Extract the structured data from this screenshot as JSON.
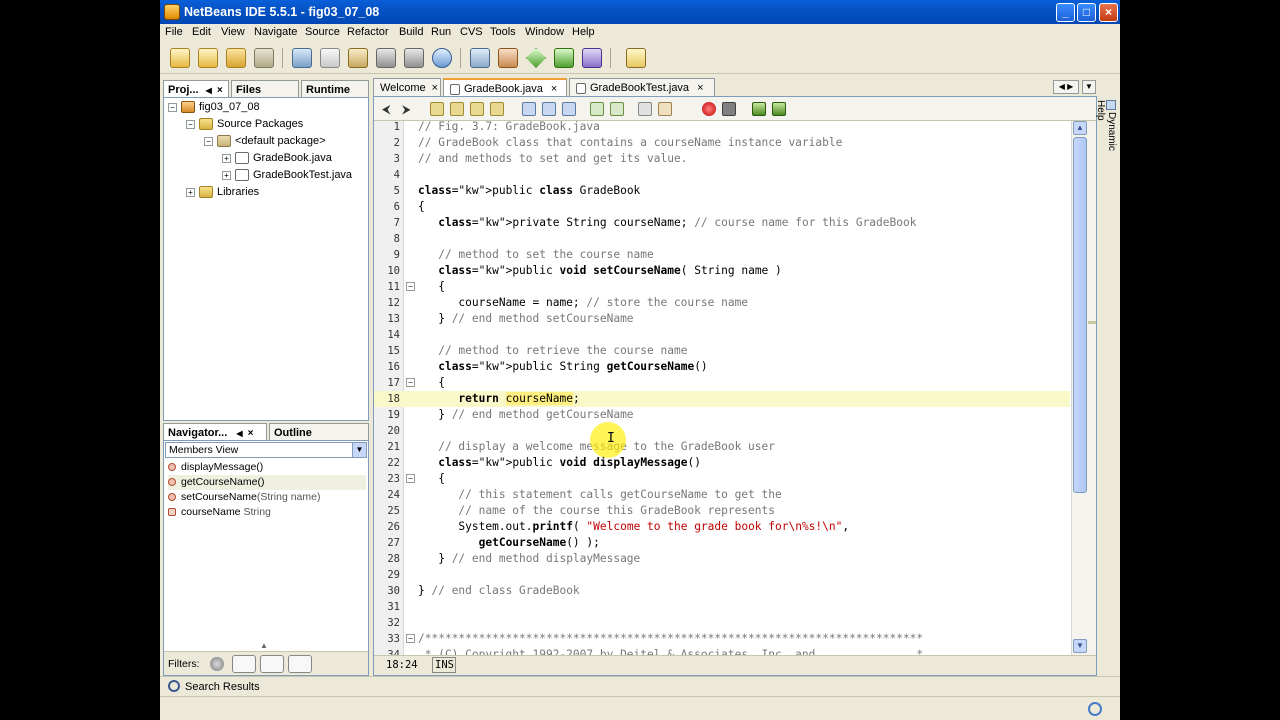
{
  "window": {
    "title": "NetBeans IDE 5.5.1 - fig03_07_08"
  },
  "menu": [
    "File",
    "Edit",
    "View",
    "Navigate",
    "Source",
    "Refactor",
    "Build",
    "Run",
    "CVS",
    "Tools",
    "Window",
    "Help"
  ],
  "left_tabs": {
    "projects": "Proj...",
    "files": "Files",
    "runtime": "Runtime"
  },
  "tree": {
    "project": "fig03_07_08",
    "source_packages": "Source Packages",
    "default_package": "<default package>",
    "file1": "GradeBook.java",
    "file2": "GradeBookTest.java",
    "libraries": "Libraries"
  },
  "navigator": {
    "tab": "Navigator...",
    "outline": "Outline",
    "view": "Members View",
    "items": [
      {
        "name": "displayMessage()",
        "type": ""
      },
      {
        "name": "getCourseName()",
        "type": ""
      },
      {
        "name": "setCourseName",
        "type": "(String name)"
      },
      {
        "name": "courseName",
        "type": " String"
      }
    ],
    "filters": "Filters:"
  },
  "editor_tabs": [
    "Welcome",
    "GradeBook.java",
    "GradeBookTest.java"
  ],
  "dynamic_help": "Dynamic Help",
  "code_lines": [
    {
      "n": "1",
      "t": "// Fig. 3.7: GradeBook.java"
    },
    {
      "n": "2",
      "t": "// GradeBook class that contains a courseName instance variable"
    },
    {
      "n": "3",
      "t": "// and methods to set and get its value."
    },
    {
      "n": "4",
      "t": ""
    },
    {
      "n": "5",
      "t": "public class GradeBook"
    },
    {
      "n": "6",
      "t": "{"
    },
    {
      "n": "7",
      "t": "   private String courseName; // course name for this GradeBook"
    },
    {
      "n": "8",
      "t": ""
    },
    {
      "n": "9",
      "t": "   // method to set the course name"
    },
    {
      "n": "10",
      "t": "   public void setCourseName( String name )"
    },
    {
      "n": "11",
      "t": "   {"
    },
    {
      "n": "12",
      "t": "      courseName = name; // store the course name"
    },
    {
      "n": "13",
      "t": "   } // end method setCourseName"
    },
    {
      "n": "14",
      "t": ""
    },
    {
      "n": "15",
      "t": "   // method to retrieve the course name"
    },
    {
      "n": "16",
      "t": "   public String getCourseName()"
    },
    {
      "n": "17",
      "t": "   {"
    },
    {
      "n": "18",
      "t": "      return courseName;"
    },
    {
      "n": "19",
      "t": "   } // end method getCourseName"
    },
    {
      "n": "20",
      "t": ""
    },
    {
      "n": "21",
      "t": "   // display a welcome message to the GradeBook user"
    },
    {
      "n": "22",
      "t": "   public void displayMessage()"
    },
    {
      "n": "23",
      "t": "   {"
    },
    {
      "n": "24",
      "t": "      // this statement calls getCourseName to get the"
    },
    {
      "n": "25",
      "t": "      // name of the course this GradeBook represents"
    },
    {
      "n": "26",
      "t": "      System.out.printf( \"Welcome to the grade book for\\n%s!\\n\","
    },
    {
      "n": "27",
      "t": "         getCourseName() );"
    },
    {
      "n": "28",
      "t": "   } // end method displayMessage"
    },
    {
      "n": "29",
      "t": ""
    },
    {
      "n": "30",
      "t": "} // end class GradeBook"
    },
    {
      "n": "31",
      "t": ""
    },
    {
      "n": "32",
      "t": ""
    },
    {
      "n": "33",
      "t": "/**************************************************************************"
    },
    {
      "n": "34",
      "t": " * (C) Copyright 1992-2007 by Deitel & Associates, Inc. and               *"
    }
  ],
  "status": {
    "position": "18:24",
    "mode": "INS"
  },
  "bottom": {
    "search_results": "Search Results"
  }
}
